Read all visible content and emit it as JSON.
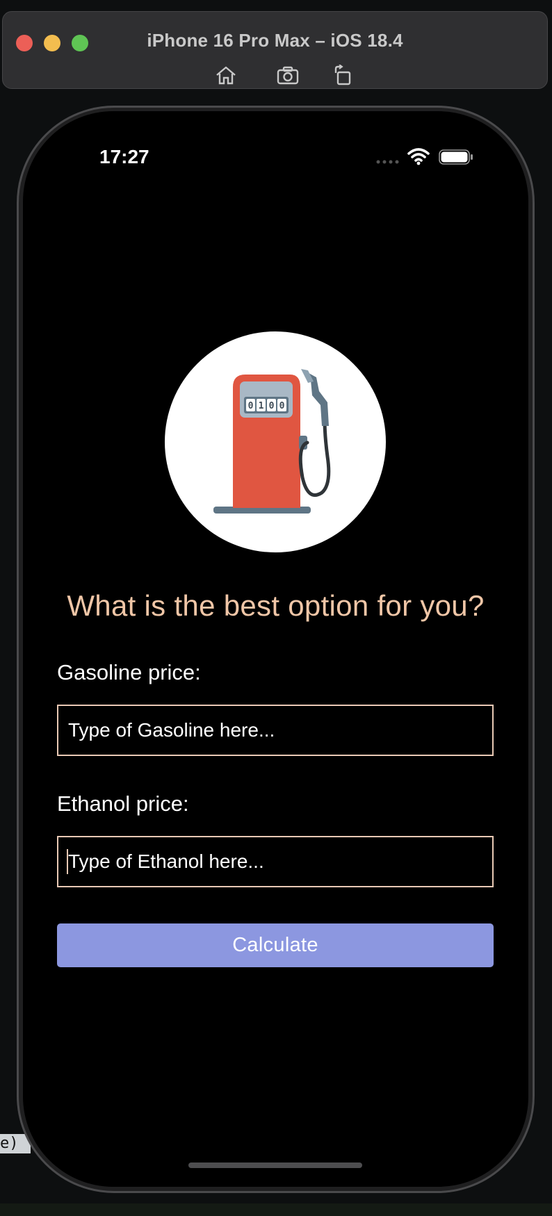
{
  "simulator": {
    "title": "iPhone 16 Pro Max – iOS 18.4",
    "toolbar": [
      "home-icon",
      "screenshot-icon",
      "rotate-icon"
    ]
  },
  "status_bar": {
    "time": "17:27",
    "icons": [
      "cellular-dots-icon",
      "wifi-icon",
      "battery-icon"
    ]
  },
  "logo": {
    "pump_display": "0100",
    "icon": "fuel-pump-icon",
    "colors": {
      "pump": "#e05641",
      "panel": "#a9b8c5",
      "base": "#5f7585"
    }
  },
  "headline": "What is the best option for you?",
  "form": {
    "gasoline": {
      "label": "Gasoline price:",
      "placeholder": "Type of Gasoline here...",
      "value": ""
    },
    "ethanol": {
      "label": "Ethanol price:",
      "placeholder": "Type of Ethanol here...",
      "value": ""
    },
    "calculate_label": "Calculate"
  },
  "colors": {
    "headline": "#f0c6a7",
    "input_border": "#e9c9b5",
    "button": "#8c97e0",
    "background": "#000000"
  },
  "background_fragments": {
    "bottom_left": "e)"
  }
}
